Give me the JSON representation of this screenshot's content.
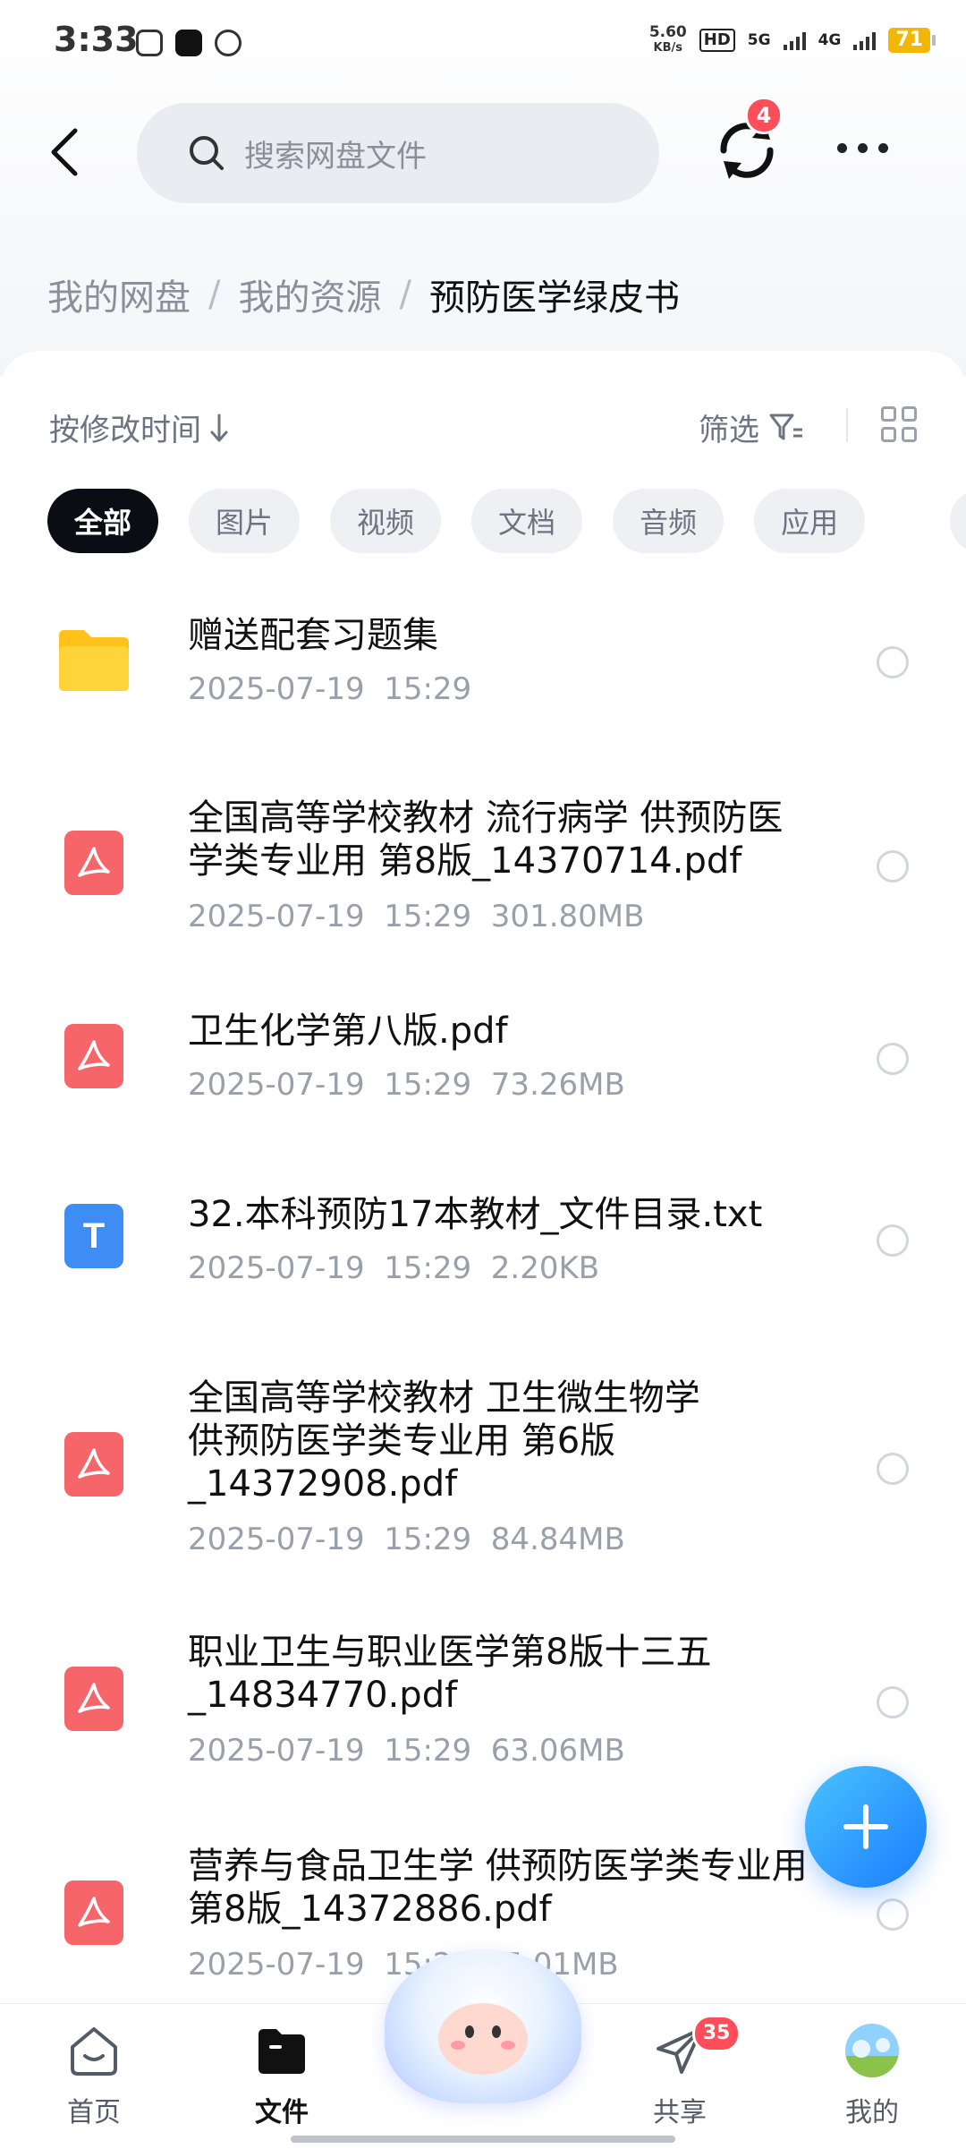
{
  "status_bar": {
    "time": "3:33",
    "speed_value": "5.60",
    "speed_unit": "KB/s",
    "hd_label": "HD",
    "net1": "5G",
    "net2": "4G",
    "battery": "71"
  },
  "header": {
    "search_placeholder": "搜索网盘文件",
    "sync_badge": "4"
  },
  "breadcrumb": {
    "items": [
      "我的网盘",
      "我的资源",
      "预防医学绿皮书"
    ],
    "separator": "/"
  },
  "toolbar": {
    "sort_label": "按修改时间",
    "filter_label": "筛选"
  },
  "filters": {
    "chips": [
      "全部",
      "图片",
      "视频",
      "文档",
      "音频",
      "应用"
    ],
    "selected": "全部"
  },
  "files": [
    {
      "type": "folder",
      "name": "赠送配套习题集",
      "meta": "2025-07-19  15:29"
    },
    {
      "type": "pdf",
      "name": "全国高等学校教材  流行病学  供预防医学类专业用  第8版_14370714.pdf",
      "meta": "2025-07-19  15:29  301.80MB"
    },
    {
      "type": "pdf",
      "name": "卫生化学第八版.pdf",
      "meta": "2025-07-19  15:29  73.26MB"
    },
    {
      "type": "txt",
      "name": "32.本科预防17本教材_文件目录.txt",
      "meta": "2025-07-19  15:29  2.20KB"
    },
    {
      "type": "pdf",
      "name": "全国高等学校教材  卫生微生物学  供预防医学类专业用  第6版_14372908.pdf",
      "meta": "2025-07-19  15:29  84.84MB"
    },
    {
      "type": "pdf",
      "name": "职业卫生与职业医学第8版十三五_14834770.pdf",
      "meta": "2025-07-19  15:29  63.06MB"
    },
    {
      "type": "pdf",
      "name": "营养与食品卫生学  供预防医学类专业用  第8版_14372886.pdf",
      "meta": "2025-07-19  15:2?  ?5.01MB"
    }
  ],
  "bottom_nav": {
    "home": "首页",
    "files": "文件",
    "share": "共享",
    "share_badge": "35",
    "mine": "我的"
  },
  "colors": {
    "accent_blue": "#1a7dff",
    "pdf_red": "#f5656a",
    "txt_blue": "#3d8df5",
    "folder_yellow": "#ffd43b",
    "badge_red": "#ff4d5a"
  }
}
